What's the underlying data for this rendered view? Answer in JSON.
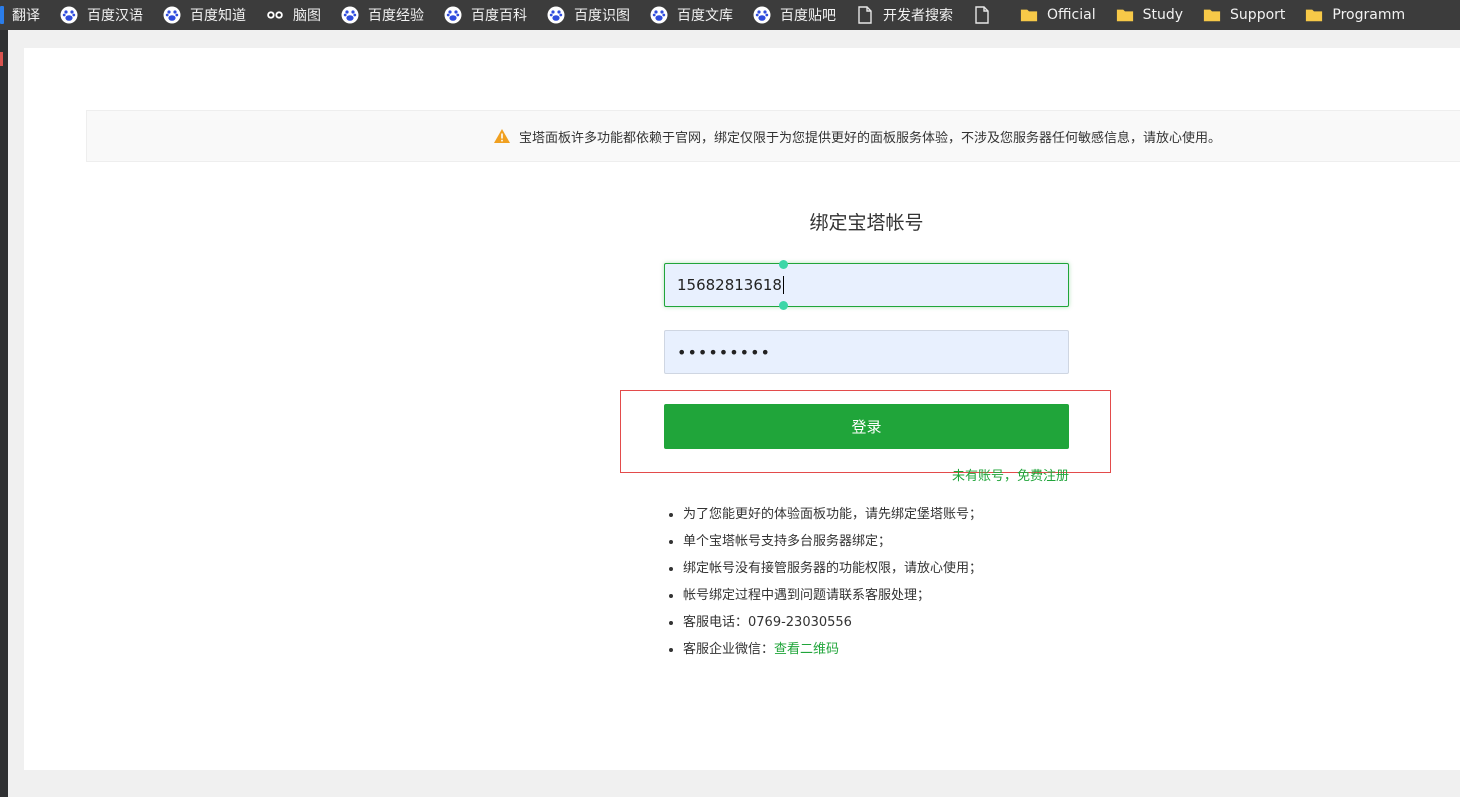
{
  "bookmarks": [
    {
      "label": "翻译",
      "icon": "translate-icon"
    },
    {
      "label": "百度汉语",
      "icon": "baidu-paw-icon"
    },
    {
      "label": "百度知道",
      "icon": "baidu-paw-icon"
    },
    {
      "label": "脑图",
      "icon": "mindmap-eyes-icon"
    },
    {
      "label": "百度经验",
      "icon": "baidu-paw-icon"
    },
    {
      "label": "百度百科",
      "icon": "baidu-paw-icon"
    },
    {
      "label": "百度识图",
      "icon": "baidu-paw-icon"
    },
    {
      "label": "百度文库",
      "icon": "baidu-paw-icon"
    },
    {
      "label": "百度贴吧",
      "icon": "baidu-paw-icon"
    },
    {
      "label": "开发者搜索",
      "icon": "page-icon"
    },
    {
      "label": "",
      "icon": "page-icon"
    },
    {
      "label": "Official",
      "icon": "folder-icon"
    },
    {
      "label": "Study",
      "icon": "folder-icon"
    },
    {
      "label": "Support",
      "icon": "folder-icon"
    },
    {
      "label": "Programm",
      "icon": "folder-icon"
    }
  ],
  "notice": {
    "text": "宝塔面板许多功能都依赖于官网，绑定仅限于为您提供更好的面板服务体验，不涉及您服务器任何敏感信息，请放心使用。",
    "icon": "warning-icon"
  },
  "form": {
    "title": "绑定宝塔帐号",
    "username_value": "15682813618",
    "password_value": "•••••••••",
    "login_label": "登录",
    "register_label": "未有账号，免费注册"
  },
  "tips": {
    "items": [
      "为了您能更好的体验面板功能，请先绑定堡塔账号；",
      "单个宝塔帐号支持多台服务器绑定；",
      "绑定帐号没有接管服务器的功能权限，请放心使用；",
      "帐号绑定过程中遇到问题请联系客服处理；",
      "客服电话：0769-23030556",
      "客服企业微信："
    ],
    "wechat_link": "查看二维码"
  },
  "colors": {
    "accent": "#20a53a",
    "warning": "#f0a020",
    "bookmark_bar": "#3c3c3c",
    "highlight": "#e34b4b"
  }
}
